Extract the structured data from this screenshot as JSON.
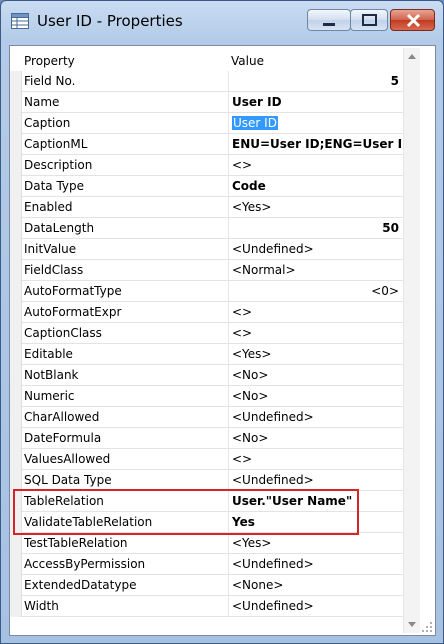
{
  "window": {
    "title": "User ID - Properties"
  },
  "table": {
    "headers": {
      "property": "Property",
      "value": "Value"
    },
    "rows": [
      {
        "property": "Field No.",
        "value": "5",
        "bold": true,
        "align": "right"
      },
      {
        "property": "Name",
        "value": "User ID",
        "bold": true
      },
      {
        "property": "Caption",
        "value": "User ID",
        "selected": true
      },
      {
        "property": "CaptionML",
        "value": "ENU=User ID;ENG=User ID",
        "bold": true
      },
      {
        "property": "Description",
        "value": "<>"
      },
      {
        "property": "Data Type",
        "value": "Code",
        "bold": true
      },
      {
        "property": "Enabled",
        "value": "<Yes>"
      },
      {
        "property": "DataLength",
        "value": "50",
        "bold": true,
        "align": "right"
      },
      {
        "property": "InitValue",
        "value": "<Undefined>"
      },
      {
        "property": "FieldClass",
        "value": "<Normal>"
      },
      {
        "property": "AutoFormatType",
        "value": "<0>",
        "align": "right"
      },
      {
        "property": "AutoFormatExpr",
        "value": "<>"
      },
      {
        "property": "CaptionClass",
        "value": "<>"
      },
      {
        "property": "Editable",
        "value": "<Yes>"
      },
      {
        "property": "NotBlank",
        "value": "<No>"
      },
      {
        "property": "Numeric",
        "value": "<No>"
      },
      {
        "property": "CharAllowed",
        "value": "<Undefined>"
      },
      {
        "property": "DateFormula",
        "value": "<No>"
      },
      {
        "property": "ValuesAllowed",
        "value": "<>"
      },
      {
        "property": "SQL Data Type",
        "value": "<Undefined>"
      },
      {
        "property": "TableRelation",
        "value": "User.\"User Name\"",
        "bold": true
      },
      {
        "property": "ValidateTableRelation",
        "value": "Yes",
        "bold": true
      },
      {
        "property": "TestTableRelation",
        "value": "<Yes>"
      },
      {
        "property": "AccessByPermission",
        "value": "<Undefined>"
      },
      {
        "property": "ExtendedDatatype",
        "value": "<None>"
      },
      {
        "property": "Width",
        "value": "<Undefined>"
      }
    ]
  },
  "colors": {
    "highlight_border": "#d7242a",
    "selection": "#3399ff"
  },
  "icons": {
    "app": "table-icon",
    "minimize": "minimize-icon",
    "maximize": "maximize-icon",
    "close": "close-icon"
  }
}
